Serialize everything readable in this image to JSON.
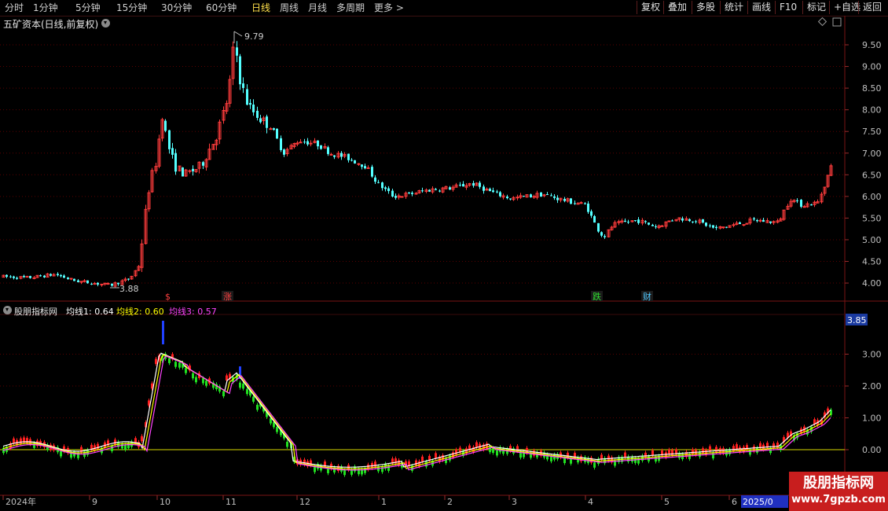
{
  "toolbar": {
    "periods": [
      "分时",
      "1分钟",
      "5分钟",
      "15分钟",
      "30分钟",
      "60分钟",
      "日线",
      "周线",
      "月线",
      "多周期",
      "更多 >"
    ],
    "active": "日线",
    "right_buttons": [
      "复权",
      "叠加",
      "多股",
      "统计",
      "画线",
      "F10",
      "标记",
      "+自选",
      "返回"
    ]
  },
  "main_panel": {
    "title": "五矿资本(日线,前复权)",
    "y_ticks": [
      "9.50",
      "9.00",
      "8.50",
      "8.00",
      "7.50",
      "7.00",
      "6.50",
      "6.00",
      "5.50",
      "5.00",
      "4.50",
      "4.00"
    ],
    "high_label": "9.79",
    "low_label": "3.88",
    "markers": [
      "$",
      "涨",
      "跌",
      "财"
    ]
  },
  "indicator_panel": {
    "name": "股朋指标网",
    "ma1": "均线1: 0.64",
    "ma2": "均线2: 0.60",
    "ma3": "均线3: 0.57",
    "y_ticks": [
      "3.00",
      "2.00",
      "1.00",
      "0.00"
    ],
    "current_value": "3.85"
  },
  "x_axis": {
    "labels": [
      "2024年",
      "9",
      "10",
      "11",
      "12",
      "1",
      "2",
      "3",
      "4",
      "5",
      "6",
      "2025/0"
    ]
  },
  "watermark": {
    "line1": "股朋指标网",
    "line2": "www.7gpzb.com"
  },
  "colors": {
    "up": "#ff3c3c",
    "down": "#54ffff",
    "active_tab": "#ffe04a",
    "ma1": "#ffffff",
    "ma2": "#ffff00",
    "ma3": "#ff44ff",
    "grid": "#5a0000",
    "indicator_up": "#ff2020",
    "indicator_down": "#20e020"
  }
}
